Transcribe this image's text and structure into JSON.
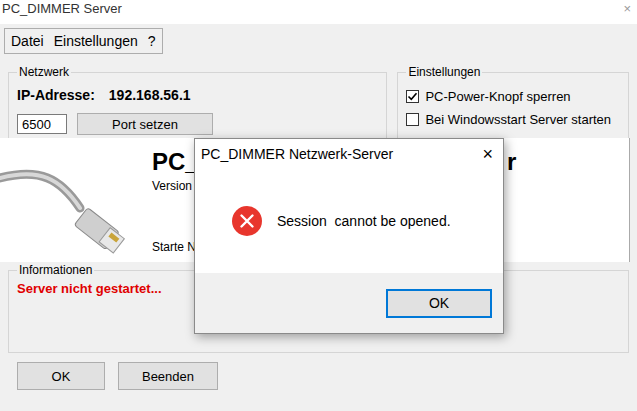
{
  "window": {
    "title": "PC_DIMMER Server",
    "close": "×"
  },
  "menu": [
    "Datei",
    "Einstellungen",
    "?"
  ],
  "network": {
    "label": "Netzwerk",
    "ip_label": "IP-Adresse:",
    "ip": "192.168.56.1",
    "port": "6500",
    "port_button": "Port setzen"
  },
  "settings": {
    "label": "Einstellungen",
    "options": [
      {
        "label": "PC-Power-Knopf sperren",
        "checked": true
      },
      {
        "label": "Bei Windowsstart Server starten",
        "checked": false
      }
    ]
  },
  "splash": {
    "title_left": "PC_",
    "title_right": "r",
    "version": "Version",
    "status": "Starte N"
  },
  "info": {
    "label": "Informationen",
    "message": "Server nicht gestartet..."
  },
  "buttons": [
    "OK",
    "Beenden"
  ],
  "dialog": {
    "title": "PC_DIMMER Netzwerk-Server",
    "close": "×",
    "message": "Session  cannot be opened.",
    "button": "OK"
  }
}
